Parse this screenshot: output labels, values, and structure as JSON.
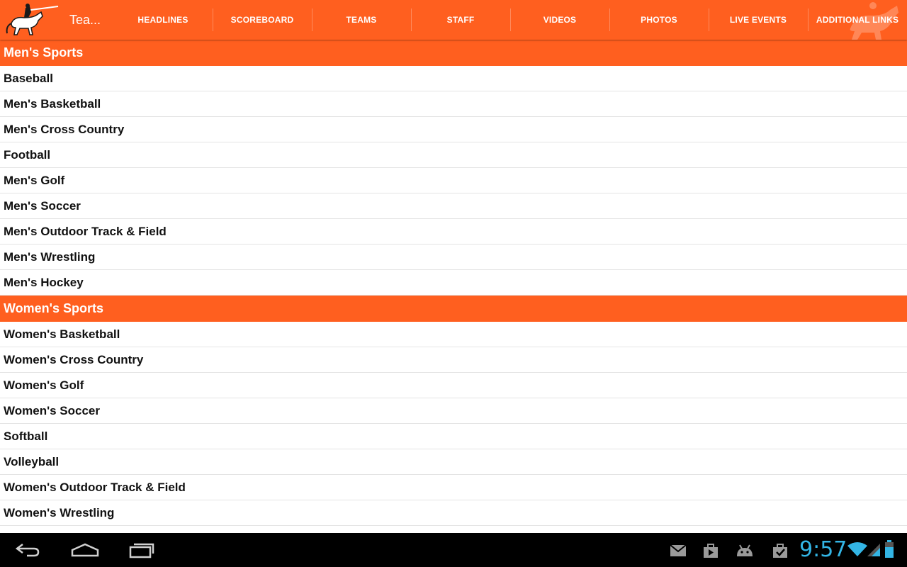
{
  "app": {
    "title": "Tea...",
    "accent_color": "#ff5f1f",
    "logo_icon": "knight-on-horse-logo"
  },
  "tabs": [
    {
      "label": "HEADLINES"
    },
    {
      "label": "SCOREBOARD"
    },
    {
      "label": "TEAMS"
    },
    {
      "label": "STAFF"
    },
    {
      "label": "VIDEOS"
    },
    {
      "label": "PHOTOS"
    },
    {
      "label": "LIVE EVENTS"
    },
    {
      "label": "ADDITIONAL LINKS"
    }
  ],
  "sections": [
    {
      "title": "Men's Sports",
      "items": [
        "Baseball",
        "Men's Basketball",
        "Men's Cross Country",
        "Football",
        "Men's Golf",
        "Men's Soccer",
        "Men's Outdoor Track & Field",
        "Men's Wrestling",
        "Men's Hockey"
      ]
    },
    {
      "title": "Women's Sports",
      "items": [
        "Women's Basketball",
        "Women's Cross Country",
        "Women's Golf",
        "Women's Soccer",
        "Softball",
        "Volleyball",
        "Women's Outdoor Track & Field",
        "Women's Wrestling"
      ]
    }
  ],
  "system_bar": {
    "clock": "9:57",
    "clock_color": "#33b5e5",
    "nav_icons": [
      "back-icon",
      "home-icon",
      "recent-apps-icon"
    ],
    "notification_icons": [
      "gmail-icon",
      "play-store-icon",
      "android-icon",
      "download-done-icon"
    ],
    "status_icons": [
      "wifi-icon",
      "signal-icon",
      "battery-icon"
    ]
  }
}
